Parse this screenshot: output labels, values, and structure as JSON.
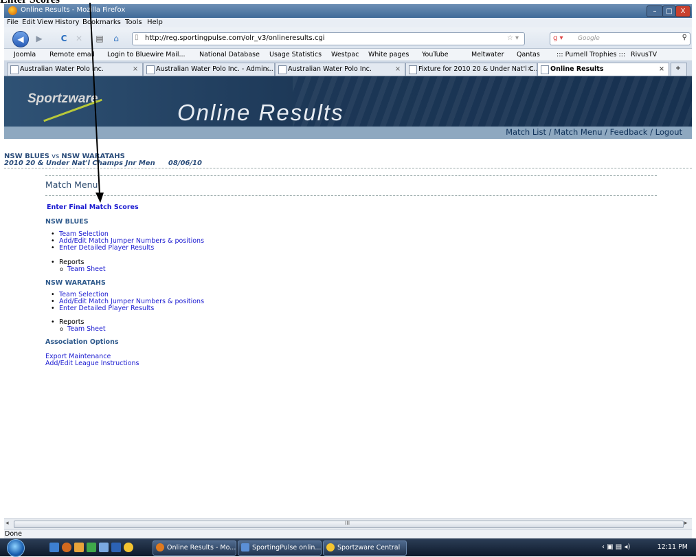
{
  "annotation": {
    "text": "Enter Scores"
  },
  "window": {
    "title": "Online Results - Mozilla Firefox",
    "minimize": "–",
    "maximize": "□",
    "close": "X"
  },
  "menu": [
    "File",
    "Edit",
    "View",
    "History",
    "Bookmarks",
    "Tools",
    "Help"
  ],
  "nav": {
    "url": "http://reg.sportingpulse.com/olr_v3/onlineresults.cgi",
    "search_placeholder": "Google"
  },
  "bookmarks": [
    "Joomla",
    "Remote email",
    "Login to Bluewire Mail...",
    "National Database",
    "Usage Statistics",
    "Westpac",
    "White pages",
    "YouTube",
    "Meltwater",
    "Qantas",
    "::: Purnell Trophies :::",
    "RivusTV"
  ],
  "tabs": [
    {
      "label": "Australian Water Polo Inc.",
      "close": "×"
    },
    {
      "label": "Australian Water Polo Inc. - Admin...",
      "close": "×"
    },
    {
      "label": "Australian Water Polo Inc.",
      "close": "×"
    },
    {
      "label": "Fixture for 2010 20 & Under Nat'l C...",
      "close": "×"
    },
    {
      "label": "Online Results",
      "close": "×"
    }
  ],
  "tab_new": "+",
  "banner": {
    "logo": "Sportzware",
    "title": "Online Results"
  },
  "subnav": "Match List / Match Menu / Feedback / Logout",
  "match": {
    "team1": "NSW BLUES",
    "vs": "vs",
    "team2": "NSW WARATAHS",
    "competition": "2010 20 & Under Nat'l Champs Jnr Men",
    "date": "08/06/10"
  },
  "menu_title": "Match Menu",
  "enter_scores": "Enter Final Match Scores",
  "teams": [
    {
      "name": "NSW BLUES",
      "links": [
        "Team Selection",
        "Add/Edit Match Jumper Numbers & positions",
        "Enter Detailed Player Results"
      ],
      "reports_label": "Reports",
      "report": "Team Sheet"
    },
    {
      "name": "NSW WARATAHS",
      "links": [
        "Team Selection",
        "Add/Edit Match Jumper Numbers & positions",
        "Enter Detailed Player Results"
      ],
      "reports_label": "Reports",
      "report": "Team Sheet"
    }
  ],
  "association": {
    "title": "Association Options",
    "links": [
      "Export Maintenance",
      "Add/Edit League Instructions"
    ]
  },
  "scroll_marker": "III",
  "status": "Done",
  "taskbar": {
    "items": [
      "Online Results - Mo...",
      "SportingPulse onlin...",
      "Sportzware Central"
    ],
    "clock": "12:11 PM"
  },
  "colors": {
    "link": "#1a1ad0",
    "section": "#2f5a8c",
    "banner": "#1c3756",
    "subnav": "#8ea8c0"
  }
}
